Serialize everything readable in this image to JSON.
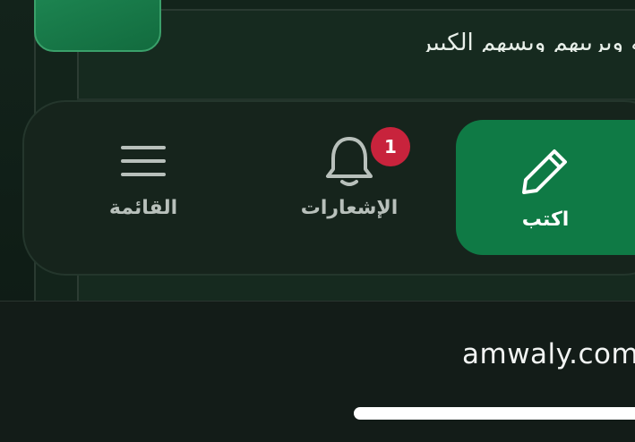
{
  "content": {
    "snippet_text": "لوكه ويريبهم ويسهم الكبير"
  },
  "bottom_nav": {
    "menu": {
      "label": "القائمة",
      "icon": "hamburger-menu-icon"
    },
    "notifications": {
      "label": "الإشعارات",
      "icon": "bell-icon",
      "badge_count": "1"
    },
    "write": {
      "label": "اكتب",
      "icon": "pencil-icon"
    }
  },
  "browser": {
    "url": "amwaly.com"
  },
  "colors": {
    "accent_green": "#0f7a45",
    "badge_red": "#c8233c",
    "background": "#13231b"
  }
}
